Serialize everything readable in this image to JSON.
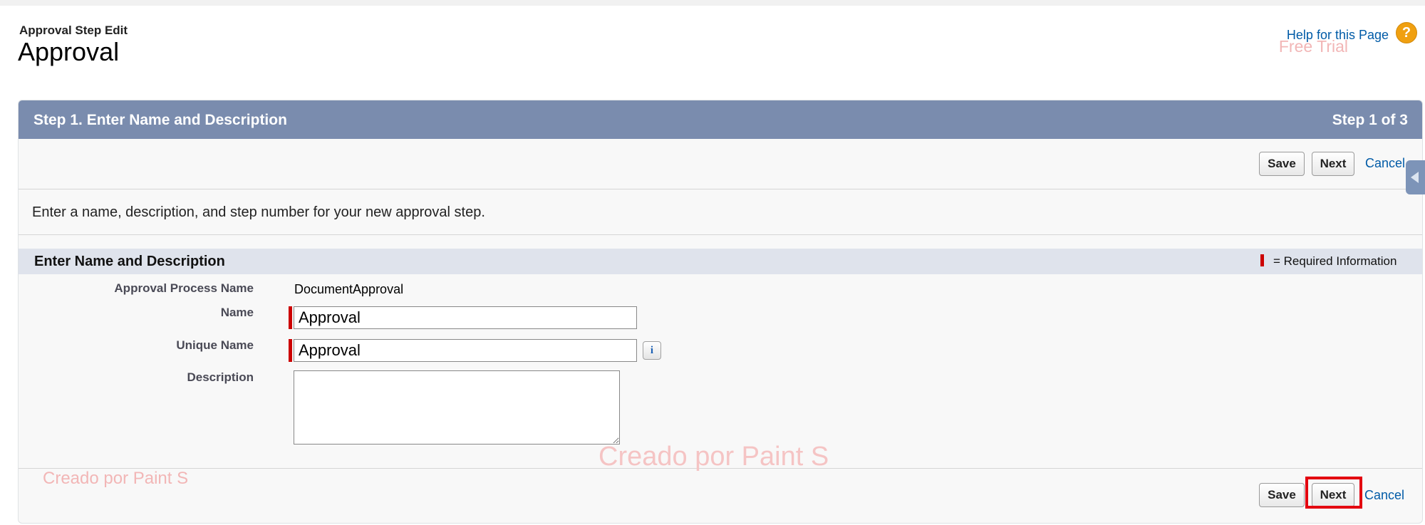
{
  "header": {
    "page_type": "Approval Step Edit",
    "title": "Approval",
    "help_link": "Help for this Page",
    "help_icon": "?"
  },
  "watermarks": {
    "top": "Free Trial",
    "center": "Creado por Paint S",
    "bottom": "Creado por Paint S"
  },
  "step": {
    "title": "Step 1. Enter Name and Description",
    "progress": "Step 1 of 3"
  },
  "buttons": {
    "save": "Save",
    "next": "Next",
    "cancel": "Cancel"
  },
  "instructions": "Enter a name, description, and step number for your new approval step.",
  "section": {
    "title": "Enter Name and Description",
    "required_legend": "= Required Information"
  },
  "fields": {
    "approval_process_name_label": "Approval Process Name",
    "approval_process_name_value": "DocumentApproval",
    "name_label": "Name",
    "name_value": "Approval",
    "unique_name_label": "Unique Name",
    "unique_name_value": "Approval",
    "info_icon": "i",
    "description_label": "Description",
    "description_value": ""
  },
  "colors": {
    "header_bar": "#7a8cae",
    "section_bar": "#dfe3ec",
    "required": "#cc0000",
    "link": "#015ba7",
    "highlight": "#e3000f"
  }
}
